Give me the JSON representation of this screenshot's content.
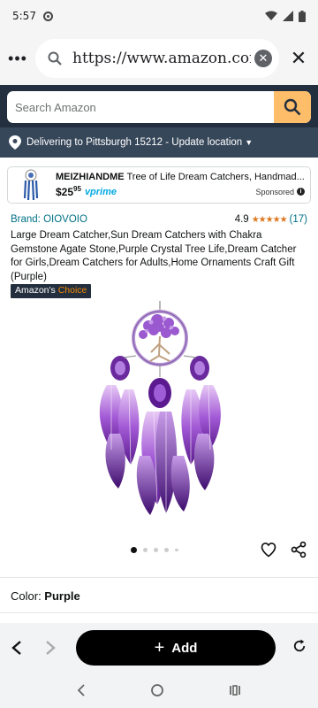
{
  "status_bar": {
    "time": "5:57"
  },
  "browser": {
    "url": "https://www.amazon.com/",
    "menu_icon": "more-dots-icon",
    "search_icon": "search-icon",
    "clear_icon": "clear-icon",
    "close_label": "✕"
  },
  "amazon": {
    "search_placeholder": "Search Amazon",
    "delivery_text": "Delivering to Pittsburgh 15212 - Update location"
  },
  "sponsored_ad": {
    "brand": "MEIZHIANDME",
    "title": " Tree of Life Dream Catchers, Handmad...",
    "price_dollars": "$25",
    "price_cents": "95",
    "prime": "vprime",
    "label": "Sponsored"
  },
  "product": {
    "brand": "Brand: OIOVOIO",
    "rating": "4.9",
    "stars": "★★★★★",
    "review_count": "(17)",
    "title": "Large Dream Catcher,Sun Dream Catchers with Chakra Gemstone Agate Stone,Purple Crystal Tree Life,Dream Catcher for Girls,Dream Catchers for Adults,Home Ornaments Craft Gift (Purple)",
    "badge_prefix": "Amazon's",
    "badge_suffix": " Choice",
    "image_count": 5,
    "active_image": 1,
    "color_label": "Color: ",
    "color_value": "Purple"
  },
  "bottom_bar": {
    "add_label": "Add"
  },
  "colors": {
    "amazon_header": "#232f3e",
    "delivery_bar": "#37475a",
    "search_button": "#febd69",
    "link": "#007185",
    "star": "#de7921"
  }
}
